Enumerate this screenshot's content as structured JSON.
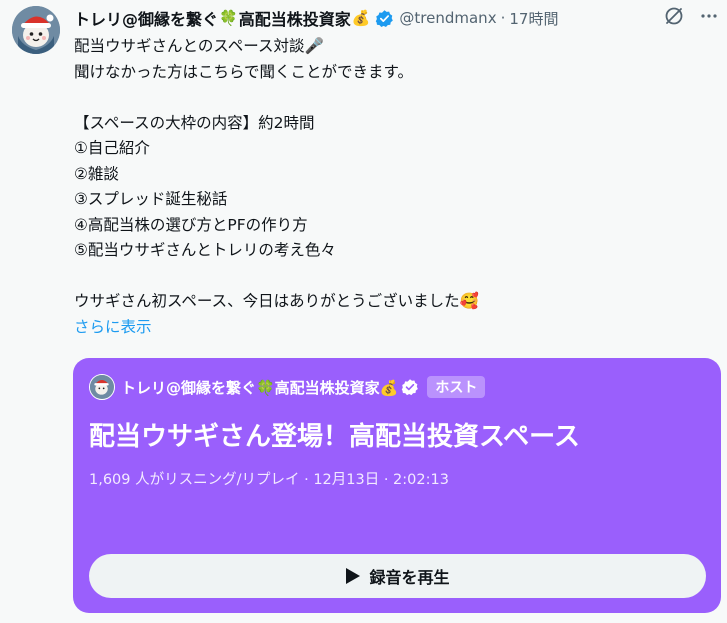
{
  "tweet": {
    "author": {
      "display_name": "トレリ@御縁を繋ぐ",
      "name_emoji_clover": "🍀",
      "display_name_suffix": "高配当株投資家",
      "name_emoji_moneybag": "💰",
      "verified_icon": "verified-badge-icon",
      "handle": "@trendmanx",
      "separator": "·",
      "timestamp": "17時間"
    },
    "icons": {
      "avatar": "santa-hat-character-avatar",
      "grok": "grok-icon",
      "more": "more-options-icon"
    },
    "body": {
      "line1": "配当ウサギさんとのスペース対談🎤",
      "line2": "聞けなかった方はこちらで聞くことができます。",
      "line3": "",
      "line4": "【スペースの大枠の内容】約2時間",
      "line5": "①自己紹介",
      "line6": "②雑談",
      "line7": "③スプレッド誕生秘話",
      "line8": "④高配当株の選び方とPFの作り方",
      "line9": "⑤配当ウサギさんとトレリの考え色々",
      "line10": "",
      "line11": "ウサギさん初スペース、今日はありがとうございました🥰",
      "show_more": "さらに表示"
    },
    "space_card": {
      "host_name": "トレリ@御縁を繋ぐ🍀高配当株投資家💰",
      "host_badge": "ホスト",
      "title": "配当ウサギさん登場！高配当投資スペース",
      "meta": "1,609 人がリスニング/リプレイ · 12月13日 · 2:02:13",
      "play_label": "録音を再生",
      "play_icon": "play-icon",
      "card_color": "#9a5ffc"
    },
    "colors": {
      "link": "#1d9bf0",
      "verified": "#1d9bf0",
      "secondary_text": "#536471"
    }
  }
}
